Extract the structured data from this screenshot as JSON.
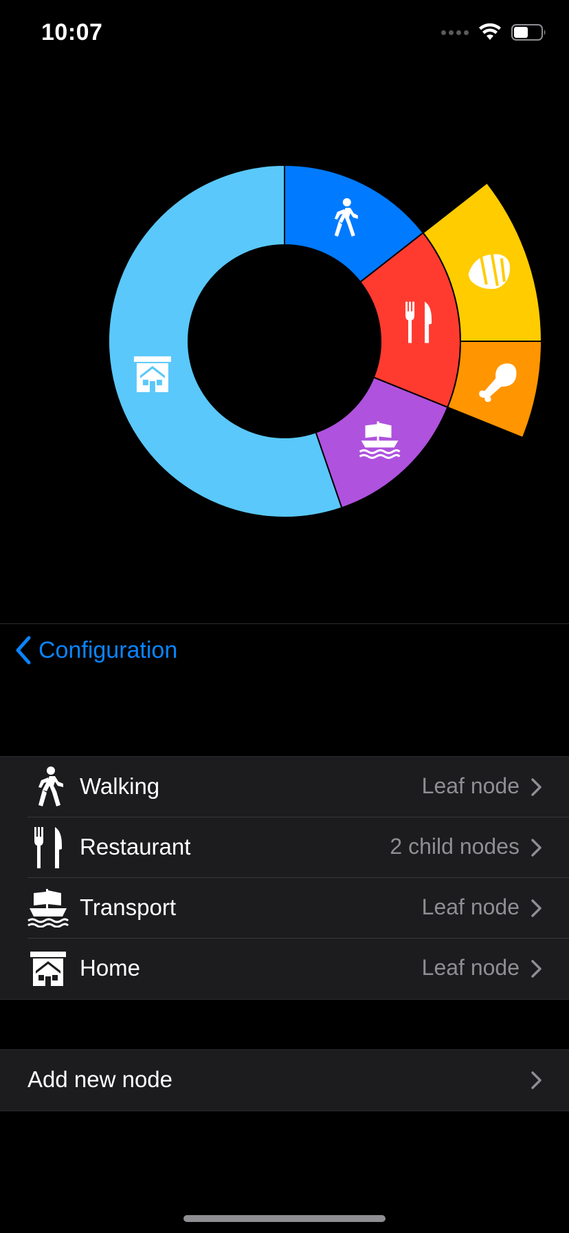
{
  "status": {
    "time": "10:07"
  },
  "nav": {
    "back_label": "Configuration"
  },
  "nodes": [
    {
      "label": "Walking",
      "detail": "Leaf node",
      "icon": "walking-icon"
    },
    {
      "label": "Restaurant",
      "detail": "2 child nodes",
      "icon": "fork-knife-icon"
    },
    {
      "label": "Transport",
      "detail": "Leaf node",
      "icon": "ship-icon"
    },
    {
      "label": "Home",
      "detail": "Leaf node",
      "icon": "house-icon"
    }
  ],
  "add_node": {
    "label": "Add new node"
  },
  "chart_data": {
    "type": "pie",
    "colors": {
      "walking": "#007aff",
      "restaurant": "#ff3b30",
      "transport": "#af52de",
      "home": "#5ac8fa",
      "pastry": "#ffcc00",
      "meat": "#ff9500"
    }
  }
}
